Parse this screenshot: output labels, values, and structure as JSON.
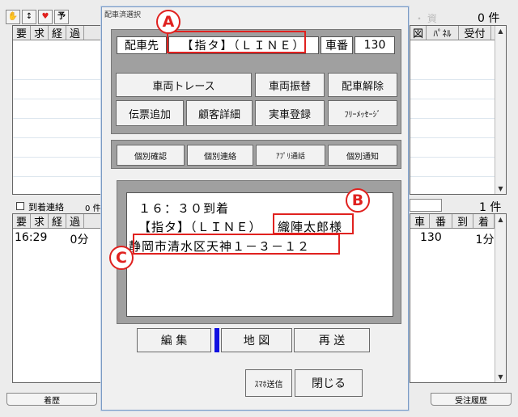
{
  "toolbar": {
    "btn1_glyph": "✋",
    "btn2_glyph": "↕",
    "btn3_glyph": "♥",
    "btn4_label": "予"
  },
  "left_top": {
    "headers": [
      "要",
      "求",
      "経",
      "過"
    ]
  },
  "right_top": {
    "count_label": "0 件",
    "faded_label": "・ 資",
    "headers": [
      "図",
      "ﾊﾟﾈﾙ",
      "受付"
    ]
  },
  "left_bottom": {
    "checkbox_label": "到着連絡",
    "count_label": "0 件",
    "headers": [
      "要",
      "求",
      "経",
      "過"
    ],
    "row": {
      "time": "16:29",
      "elapsed": "0分"
    }
  },
  "right_bottom": {
    "count_label": "1 件",
    "headers": [
      "車",
      "番",
      "到",
      "着"
    ],
    "row": {
      "car_no": "130",
      "arrival": "1分"
    }
  },
  "bottom_tabs": {
    "left": "着歴",
    "right": "受注履歴"
  },
  "dialog": {
    "title": "配車済選択",
    "dispatch_label": "配車先",
    "dispatch_value": "【指タ】（ＬＩＮＥ）",
    "car_no_label": "車番",
    "car_no_value": "130",
    "buttons_row1": [
      "車両トレース",
      "車両振替",
      "配車解除"
    ],
    "buttons_row2": [
      "伝票追加",
      "顧客詳細",
      "実車登録",
      "ﾌﾘｰﾒｯｾｰｼﾞ"
    ],
    "buttons_row3": [
      "個別確認",
      "個別連絡",
      "ｱﾌﾟﾘ通話",
      "個別通知"
    ],
    "message": {
      "line1": "１６：３０到着",
      "line2_company": "【指タ】（ＬＩＮＥ）",
      "line2_name": "織陣太郎様",
      "line3": "静岡市清水区天神１－３－１２"
    },
    "edit_buttons": [
      "編 集",
      "地 図",
      "再 送"
    ],
    "footer_buttons": [
      "ｽﾏﾎ送信",
      "閉じる"
    ]
  },
  "callouts": {
    "a": "A",
    "b": "B",
    "c": "C"
  },
  "colors": {
    "highlight": "#e0211f",
    "map_marker": "#1010e0"
  }
}
